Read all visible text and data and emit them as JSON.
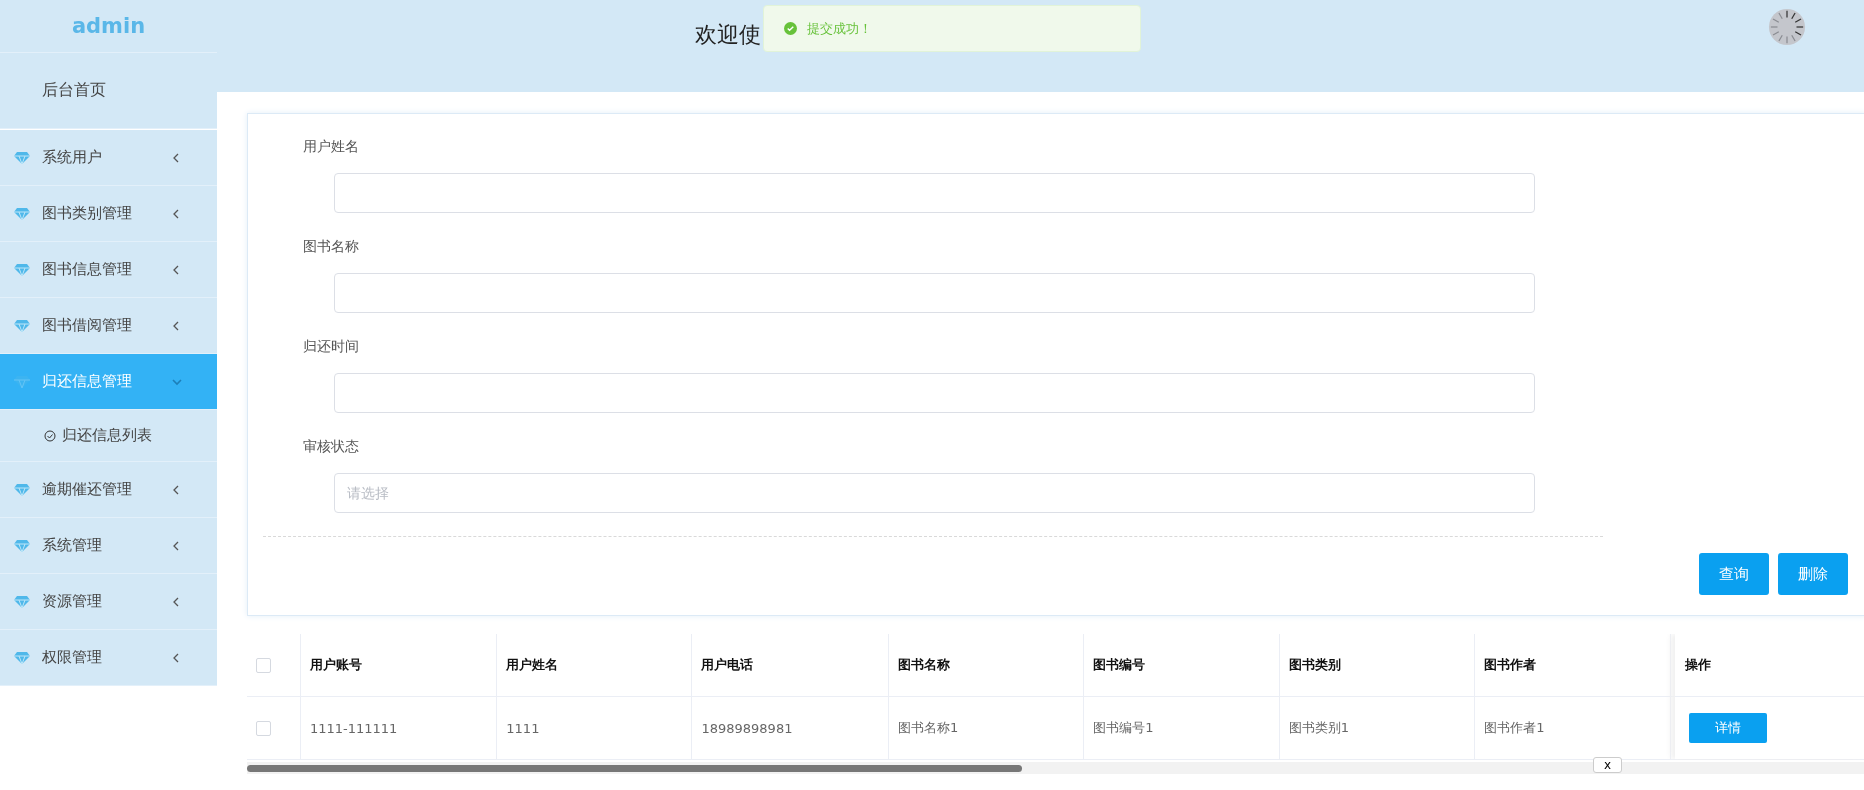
{
  "sidebar": {
    "title": "admin",
    "home": "后台首页",
    "menu": [
      {
        "label": "系统用户",
        "expanded": false,
        "selected": false
      },
      {
        "label": "图书类别管理",
        "expanded": false,
        "selected": false
      },
      {
        "label": "图书信息管理",
        "expanded": false,
        "selected": false
      },
      {
        "label": "图书借阅管理",
        "expanded": false,
        "selected": false
      },
      {
        "label": "归还信息管理",
        "expanded": true,
        "selected": true,
        "children": [
          {
            "label": "归还信息列表"
          }
        ]
      },
      {
        "label": "逾期催还管理",
        "expanded": false,
        "selected": false
      },
      {
        "label": "系统管理",
        "expanded": false,
        "selected": false
      },
      {
        "label": "资源管理",
        "expanded": false,
        "selected": false
      },
      {
        "label": "权限管理",
        "expanded": false,
        "selected": false
      }
    ]
  },
  "header": {
    "title": "欢迎使"
  },
  "toast": {
    "message": "提交成功！"
  },
  "search_form": {
    "fields": [
      {
        "label": "用户姓名",
        "kind": "input"
      },
      {
        "label": "图书名称",
        "kind": "input"
      },
      {
        "label": "归还时间",
        "kind": "input"
      },
      {
        "label": "审核状态",
        "kind": "select",
        "placeholder": "请选择"
      }
    ],
    "buttons": [
      "查询",
      "删除"
    ]
  },
  "table": {
    "columns": [
      "用户账号",
      "用户姓名",
      "用户电话",
      "图书名称",
      "图书编号",
      "图书类别",
      "图书作者"
    ],
    "action_column": "操作",
    "all_selected": false,
    "rows": [
      {
        "selected": false,
        "cells": [
          "1111-111111",
          "1111",
          "18989898981",
          "图书名称1",
          "图书编号1",
          "图书类别1",
          "图书作者1"
        ],
        "action": "详情"
      }
    ]
  },
  "scroll_tab": "x"
}
